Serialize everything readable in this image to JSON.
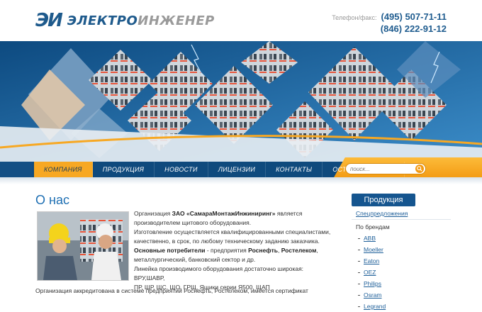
{
  "header": {
    "logo_mark": "ЭИ",
    "logo_word_a": "ЭЛЕКТРО",
    "logo_word_b": "ИНЖЕНЕР",
    "phone_label": "Телефон/факс:",
    "phone1": "(495) 507-71-11",
    "phone2": "(846) 222-91-12"
  },
  "nav": {
    "items": [
      "КОМПАНИЯ",
      "ПРОДУКЦИЯ",
      "НОВОСТИ",
      "ЛИЦЕНЗИИ",
      "КОНТАКТЫ",
      "ОСТАВИТЬ ОТЗЫВ"
    ],
    "active_index": 0
  },
  "search": {
    "placeholder": "поиск...",
    "icon": "search-icon"
  },
  "main": {
    "title": "О нас",
    "lines": [
      [
        "Организация ",
        "ЗАО «СамараМонтажИнжиниринг»",
        " является"
      ],
      [
        "производителем щитового оборудования.",
        "",
        ""
      ],
      [
        "Изготовление осуществляется квалифицированными специалистами,",
        "",
        ""
      ],
      [
        "качественно, в срок, по любому техническому заданию заказчика.",
        "",
        ""
      ],
      [
        "",
        "Основные потребители",
        " - предприятия "
      ],
      [
        "металлургический, банковский сектор и др.",
        "",
        ""
      ],
      [
        "Линейка производимого оборудования достаточно широкая: ВРУ,ШАВР,",
        "",
        ""
      ],
      [
        "ПР, ЩР, ЩС, ЩО, ГРЩ, Ящики серии Я500, ЩАП",
        "",
        ""
      ]
    ],
    "line5_bold2": "Роснефть",
    "line5_sep": ", ",
    "line5_bold3": "Ростелеком",
    "line5_end": ",",
    "footer": "Организация аккредитована в системе предприятий Роснефть, Ростелеком, имеется сертификат"
  },
  "sidebar": {
    "heading": "Продукция",
    "special": "Спецпредложения",
    "brands_label": "По брендам",
    "brands": [
      "ABB",
      "Moeller",
      "Eaton",
      "OEZ",
      "Philips",
      "Osram",
      "Legrand"
    ]
  },
  "colors": {
    "accent_blue": "#1e6fb3",
    "nav_blue": "#0f4a7d",
    "accent_orange": "#f7a823"
  }
}
